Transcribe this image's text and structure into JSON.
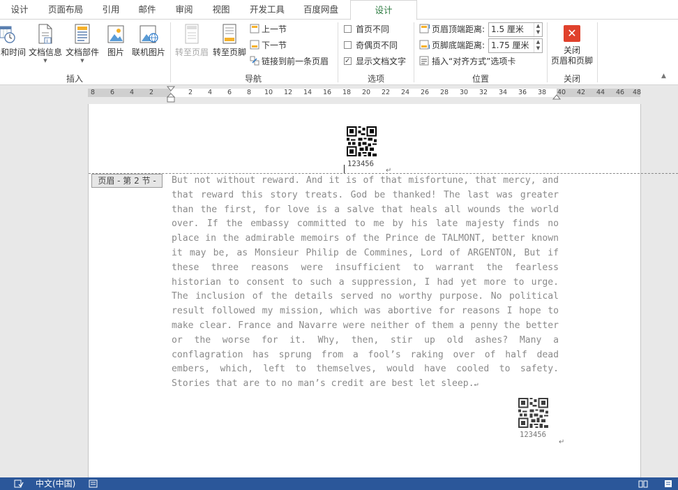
{
  "tabs": [
    {
      "label": "设计"
    },
    {
      "label": "页面布局"
    },
    {
      "label": "引用"
    },
    {
      "label": "邮件"
    },
    {
      "label": "审阅"
    },
    {
      "label": "视图"
    },
    {
      "label": "开发工具"
    },
    {
      "label": "百度网盘"
    },
    {
      "label": "设计",
      "active": true
    }
  ],
  "ribbon": {
    "insert": {
      "date_time": "和时间",
      "doc_info": "文档信息",
      "doc_parts": "文档部件",
      "picture": "图片",
      "online_picture": "联机图片",
      "group_label": "插入"
    },
    "navigation": {
      "goto_header": "转至页眉",
      "goto_footer": "转至页脚",
      "prev_section": "上一节",
      "next_section": "下一节",
      "link_previous": "链接到前一条页眉",
      "group_label": "导航"
    },
    "options": {
      "first_page_diff": "首页不同",
      "odd_even_diff": "奇偶页不同",
      "show_doc_text": "显示文档文字",
      "show_doc_text_checked": true,
      "group_label": "选项"
    },
    "position": {
      "header_from_top_label": "页眉顶端距离:",
      "header_from_top_value": "1.5 厘米",
      "footer_from_bottom_label": "页脚底端距离:",
      "footer_from_bottom_value": "1.75 厘米",
      "insert_align_tab": "插入“对齐方式”选项卡",
      "group_label": "位置"
    },
    "close": {
      "label_line1": "关闭",
      "label_line2": "页眉和页脚",
      "group_label": "关闭"
    }
  },
  "ruler": {
    "left_ticks": [
      "8",
      "6",
      "4",
      "2"
    ],
    "right_ticks": [
      "2",
      "4",
      "6",
      "8",
      "10",
      "12",
      "14",
      "16",
      "18",
      "20",
      "22",
      "24",
      "26",
      "28",
      "30",
      "32",
      "34",
      "36",
      "38",
      "40",
      "42",
      "44",
      "46",
      "48"
    ]
  },
  "document": {
    "header_tag": "页眉 - 第 2 节 -",
    "header_qr_caption": "123456",
    "body": "But not without reward. And it is of that misfortune, that mercy, and that reward this story treats. God be thanked! The last was greater than the first, for love is a salve that heals all wounds the world over. If the embassy committed to me by his late majesty finds no place in the admirable memoirs of the Prince de TALMONT, better known it may be, as Monsieur Philip de Commines, Lord of ARGENTON, But if these three reasons were insufficient to warrant the fearless historian to consent to such a suppression, I had yet more to urge. The inclusion of the details served no worthy purpose. No political result followed my mission, which was abortive for reasons I hope to make clear. France and Navarre were neither of them a penny the better or the worse for it. Why, then, stir up old ashes? Many a conflagration has sprung from a fool’s raking over of half dead embers, which, left to themselves, would have cooled to safety. Stories that are to no man’s credit are best let sleep.",
    "paragraph_mark": "↵",
    "body_qr_caption": "123456"
  },
  "status_bar": {
    "language": "中文(中国)"
  },
  "colors": {
    "accent_green": "#2b7a3f",
    "status_blue": "#2b579a",
    "close_red": "#e0412c"
  }
}
